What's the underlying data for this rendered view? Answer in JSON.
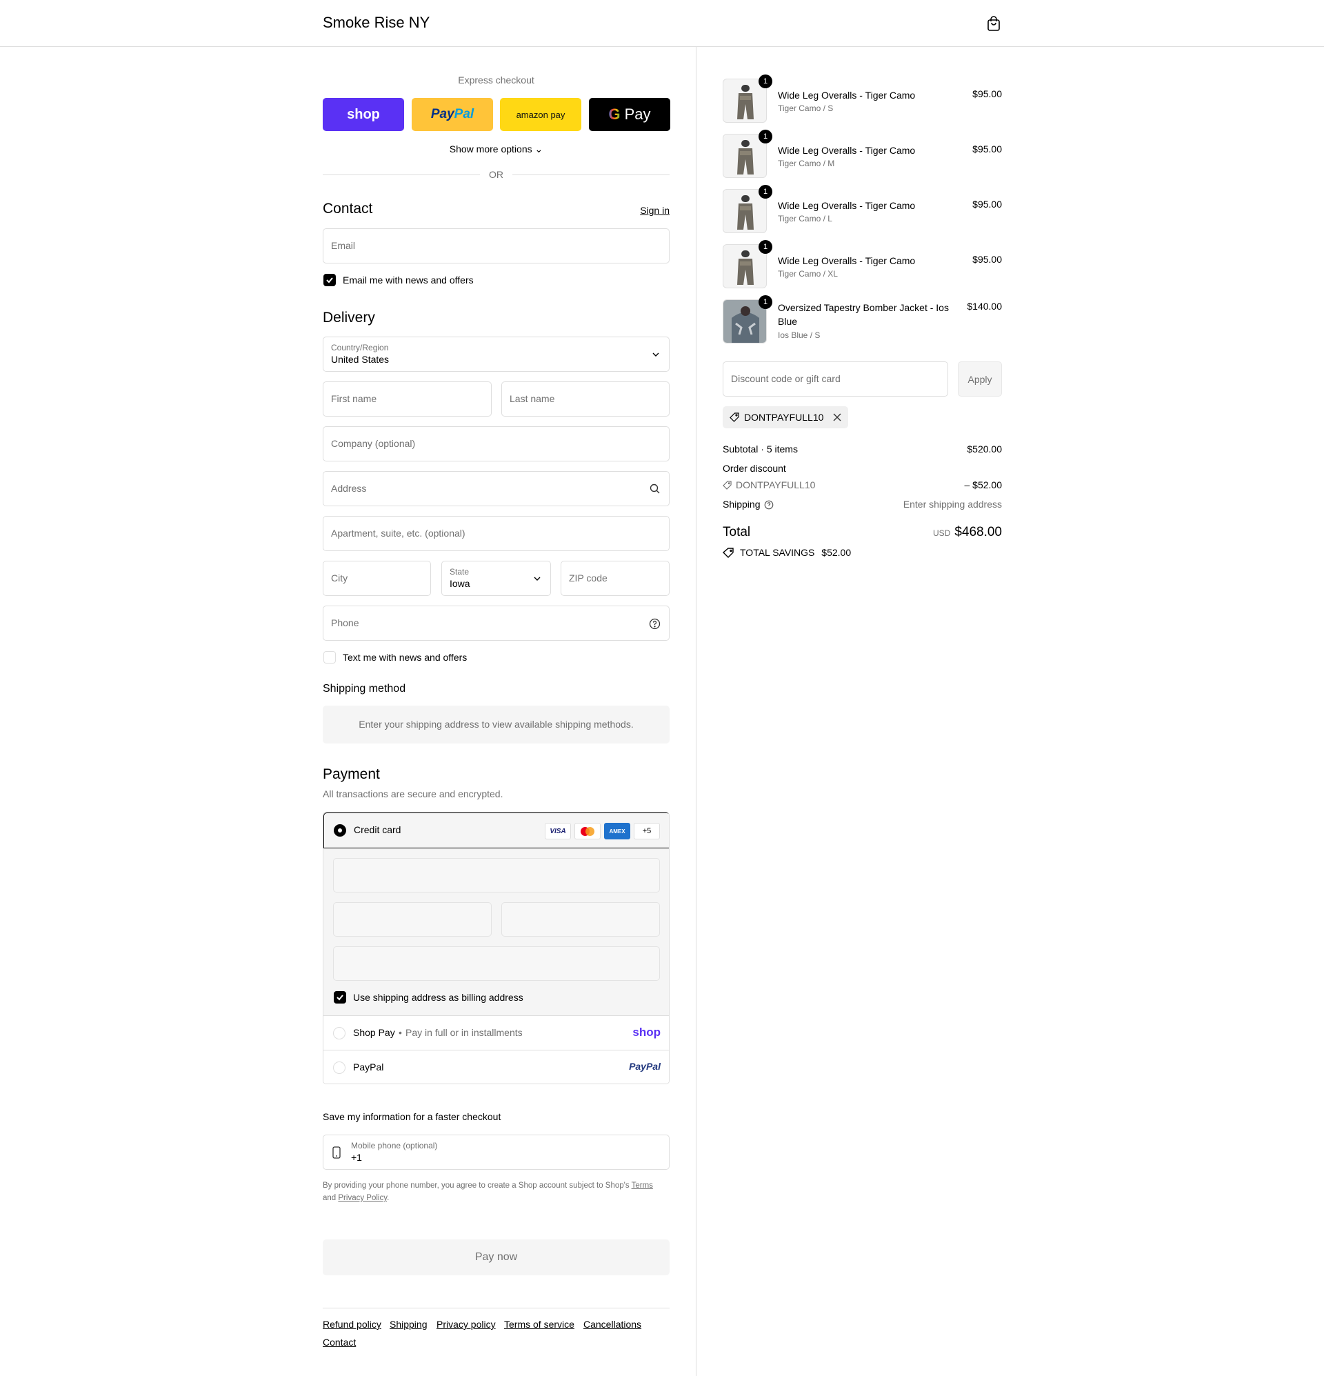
{
  "header": {
    "brand": "Smoke Rise NY",
    "cart_icon": "shopping-bag-icon"
  },
  "express": {
    "title": "Express checkout",
    "shop": "shop",
    "paypal_a": "Pay",
    "paypal_b": "Pal",
    "amazon": "amazon pay",
    "gpay": "Pay",
    "more_options": "Show more options",
    "or": "OR"
  },
  "contact": {
    "title": "Contact",
    "sign_in": "Sign in",
    "email_placeholder": "Email",
    "news_label": "Email me with news and offers"
  },
  "delivery": {
    "title": "Delivery",
    "country_label": "Country/Region",
    "country_value": "United States",
    "first_name": "First name",
    "last_name": "Last name",
    "company": "Company (optional)",
    "address": "Address",
    "apartment": "Apartment, suite, etc. (optional)",
    "city": "City",
    "state_label": "State",
    "state_value": "Iowa",
    "zip": "ZIP code",
    "phone": "Phone",
    "text_label": "Text me with news and offers"
  },
  "shipping": {
    "title": "Shipping method",
    "message": "Enter your shipping address to view available shipping methods."
  },
  "payment": {
    "title": "Payment",
    "subtitle": "All transactions are secure and encrypted.",
    "credit_card": "Credit card",
    "visa": "VISA",
    "amex": "AMEX",
    "more_cards": "+5",
    "billing_label": "Use shipping address as billing address",
    "shop_pay": "Shop Pay",
    "shop_pay_sep": "•",
    "shop_pay_desc": "Pay in full or in installments",
    "shop_pay_logo": "shop",
    "paypal": "PayPal",
    "paypal_logo": "PayPal"
  },
  "save": {
    "title": "Save my information for a faster checkout",
    "mobile_label": "Mobile phone (optional)",
    "mobile_value": "+1",
    "legal_a": "By providing your phone number, you agree to create a Shop account subject to Shop's",
    "terms": "Terms",
    "legal_and": "and",
    "privacy": "Privacy Policy",
    "legal_end": "."
  },
  "pay_now": "Pay now",
  "footer": [
    "Refund policy",
    "Shipping",
    "Privacy policy",
    "Terms of service",
    "Cancellations",
    "Contact"
  ],
  "items": [
    {
      "qty": "1",
      "name": "Wide Leg Overalls - Tiger Camo",
      "variant": "Tiger Camo / S",
      "price": "$95.00"
    },
    {
      "qty": "1",
      "name": "Wide Leg Overalls - Tiger Camo",
      "variant": "Tiger Camo / M",
      "price": "$95.00"
    },
    {
      "qty": "1",
      "name": "Wide Leg Overalls - Tiger Camo",
      "variant": "Tiger Camo / L",
      "price": "$95.00"
    },
    {
      "qty": "1",
      "name": "Wide Leg Overalls - Tiger Camo",
      "variant": "Tiger Camo / XL",
      "price": "$95.00"
    },
    {
      "qty": "1",
      "name": "Oversized Tapestry Bomber Jacket - Ios Blue",
      "variant": "Ios Blue / S",
      "price": "$140.00"
    }
  ],
  "discount": {
    "placeholder": "Discount code or gift card",
    "apply": "Apply",
    "code": "DONTPAYFULL10"
  },
  "summary": {
    "subtotal_label": "Subtotal · 5 items",
    "subtotal": "$520.00",
    "order_discount": "Order discount",
    "discount_code": "DONTPAYFULL10",
    "discount_value": "– $52.00",
    "shipping_label": "Shipping",
    "shipping_value": "Enter shipping address",
    "total_label": "Total",
    "currency": "USD",
    "total": "$468.00",
    "savings_label": "TOTAL SAVINGS",
    "savings": "$52.00"
  },
  "colors": {
    "shop_purple": "#5a31f4",
    "paypal_yellow": "#ffc439",
    "amazon_yellow": "#ffd814"
  }
}
